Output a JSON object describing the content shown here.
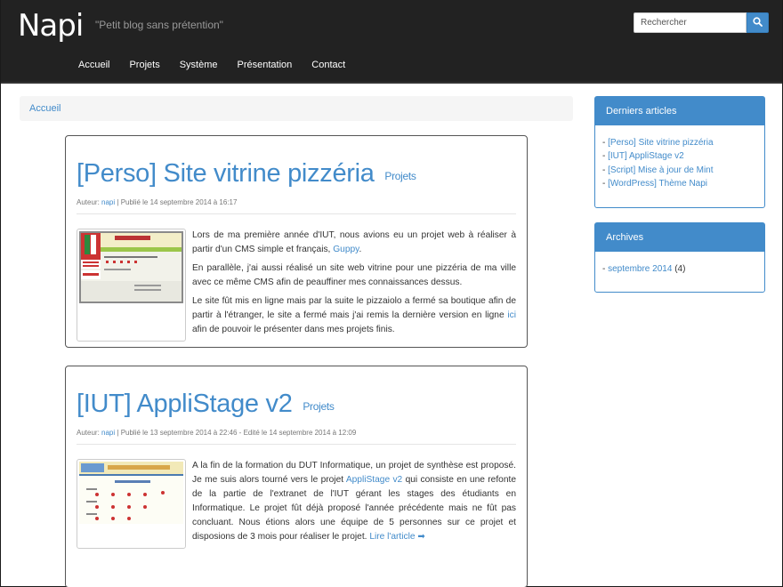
{
  "header": {
    "brand": "Napi",
    "tagline": "\"Petit blog sans prétention\"",
    "search_placeholder": "Rechercher",
    "nav": [
      "Accueil",
      "Projets",
      "Système",
      "Présentation",
      "Contact"
    ]
  },
  "breadcrumb": "Accueil",
  "posts": [
    {
      "title": "[Perso] Site vitrine pizzéria",
      "category": "Projets",
      "author_label": "Auteur:",
      "author": "napi",
      "date": "| Publié le 14 septembre 2014 à 16:17",
      "p1": "Lors de ma première année d'IUT, nous avions eu un projet web à réaliser à partir d'un CMS simple et français,",
      "p1_link": "Guppy",
      "p1_end": ".",
      "p2": "En parallèle, j'ai aussi réalisé un site web vitrine pour une pizzéria de ma ville avec ce même CMS afin de peauffiner mes connaissances dessus.",
      "p3": "Le site fût mis en ligne mais par la suite le pizzaiolo a fermé sa boutique afin de partir à l'étranger, le site a fermé mais j'ai remis la dernière version en ligne",
      "p3_link": "ici",
      "p3_end": "afin de pouvoir le présenter dans mes projets finis."
    },
    {
      "title": "[IUT] AppliStage v2",
      "category": "Projets",
      "author_label": "Auteur:",
      "author": "napi",
      "date": "| Publié le 13 septembre 2014 à 22:46 - Edité le 14 septembre 2014 à 12:09",
      "p1": "A la fin de la formation du DUT Informatique, un projet de synthèse est proposé. Je me suis alors tourné vers le projet",
      "p1_link": "AppliStage v2",
      "p1_end": "qui consiste en une refonte de la partie de l'extranet de l'IUT gérant les stages des étudiants en Informatique. Le projet fût déjà proposé l'année précédente mais ne fût pas concluant. Nous étions alors une équipe de 5 personnes sur ce projet et disposions de 3 mois pour réaliser le projet.",
      "read_more": "Lire l'article",
      "read_more_arrow": "➡"
    }
  ],
  "sidebar": {
    "recent_title": "Derniers articles",
    "recent": [
      "[Perso] Site vitrine pizzéria",
      "[IUT] AppliStage v2",
      "[Script] Mise à jour de Mint",
      "[WordPress] Thème Napi"
    ],
    "archives_title": "Archives",
    "archive_link": "septembre 2014",
    "archive_count": "(4)",
    "dash": "-"
  },
  "colors": {
    "accent": "#428bca",
    "navbar": "#222222"
  },
  "icons": {
    "search": "search-icon",
    "arrow": "arrow-right-icon"
  }
}
